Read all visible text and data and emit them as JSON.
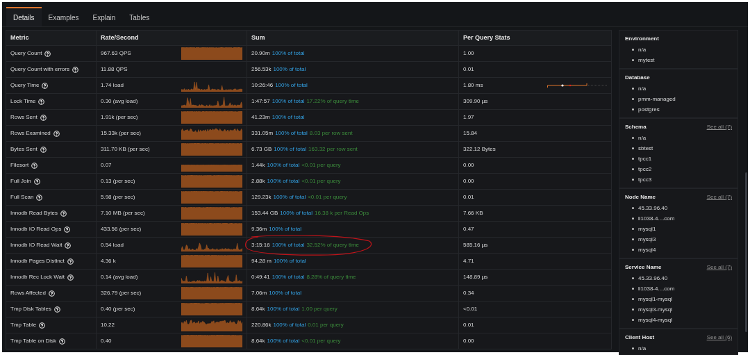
{
  "tabs": [
    {
      "label": "Details",
      "selected": true
    },
    {
      "label": "Examples",
      "selected": false
    },
    {
      "label": "Explain",
      "selected": false
    },
    {
      "label": "Tables",
      "selected": false
    }
  ],
  "table": {
    "columns": [
      "Metric",
      "Rate/Second",
      "Sum",
      "Per Query Stats"
    ],
    "rows": [
      {
        "metric": "Query Count",
        "rate": "967.63 QPS",
        "kind": "flat",
        "sum": "20.90m",
        "pct": "100% of total",
        "per_query": "1.00"
      },
      {
        "metric": "Query Count with errors",
        "rate": "11.88 QPS",
        "kind": "none",
        "sum": "256.53k",
        "pct": "100% of total",
        "per_query": "0.01"
      },
      {
        "metric": "Query Time",
        "rate": "1.74 load",
        "kind": "spiky",
        "sum": "10:26:46",
        "pct": "100% of total",
        "per_query": "1.80 ms",
        "range": true
      },
      {
        "metric": "Lock Time",
        "rate": "0.30 (avg load)",
        "kind": "spiky",
        "sum": "1:47:57",
        "pct": "100% of total",
        "note": "17.22% of query time",
        "per_query": "309.90 µs"
      },
      {
        "metric": "Rows Sent",
        "rate": "1.91k (per sec)",
        "kind": "flat",
        "sum": "41.23m",
        "pct": "100% of total",
        "per_query": "1.97"
      },
      {
        "metric": "Rows Examined",
        "rate": "15.33k (per sec)",
        "kind": "wavy",
        "sum": "331.05m",
        "pct": "100% of total",
        "note": "8.03 per row sent",
        "per_query": "15.84"
      },
      {
        "metric": "Bytes Sent",
        "rate": "311.70 KB (per sec)",
        "kind": "flat",
        "sum": "6.73 GB",
        "pct": "100% of total",
        "note": "163.32 per row sent",
        "per_query": "322.12 Bytes"
      },
      {
        "metric": "Filesort",
        "rate": "0.07",
        "kind": "low",
        "sum": "1.44k",
        "pct": "100% of total",
        "note": "<0.01 per query",
        "per_query": "0.00"
      },
      {
        "metric": "Full Join",
        "rate": "0.13 (per sec)",
        "kind": "flat",
        "sum": "2.88k",
        "pct": "100% of total",
        "note": "<0.01 per query",
        "per_query": "0.00"
      },
      {
        "metric": "Full Scan",
        "rate": "5.98 (per sec)",
        "kind": "flat",
        "sum": "129.23k",
        "pct": "100% of total",
        "note": "<0.01 per query",
        "per_query": "0.01"
      },
      {
        "metric": "Innodb Read Bytes",
        "rate": "7.10 MB (per sec)",
        "kind": "flat",
        "sum": "153.44 GB",
        "pct": "100% of total",
        "note": "16.38 k per Read Ops",
        "per_query": "7.66 KB"
      },
      {
        "metric": "Innodb IO Read Ops",
        "rate": "433.56 (per sec)",
        "kind": "flat",
        "sum": "9.36m",
        "pct": "100% of total",
        "per_query": "0.47"
      },
      {
        "metric": "Innodb IO Read Wait",
        "rate": "0.54 load",
        "kind": "spiky",
        "sum": "3:15:16",
        "pct": "100% of total",
        "note": "32.52% of query time",
        "per_query": "585.16 µs",
        "circled": true
      },
      {
        "metric": "Innodb Pages Distinct",
        "rate": "4.36 k",
        "kind": "flat",
        "sum": "94.28 m",
        "pct": "100% of total",
        "per_query": "4.71"
      },
      {
        "metric": "Innodb Rec Lock Wait",
        "rate": "0.14 (avg load)",
        "kind": "spiky",
        "sum": "0:49:41",
        "pct": "100% of total",
        "note": "8.28% of query time",
        "per_query": "148.89 µs"
      },
      {
        "metric": "Rows Affected",
        "rate": "326.79 (per sec)",
        "kind": "flat",
        "sum": "7.06m",
        "pct": "100% of total",
        "per_query": "0.34"
      },
      {
        "metric": "Tmp Disk Tables",
        "rate": "0.40 (per sec)",
        "kind": "flat",
        "sum": "8.64k",
        "pct": "100% of total",
        "note": "1.00 per query",
        "per_query": "<0.01"
      },
      {
        "metric": "Tmp Table",
        "rate": "10.22",
        "kind": "wavy",
        "sum": "220.86k",
        "pct": "100% of total",
        "note": "0.01 per query",
        "per_query": "0.01"
      },
      {
        "metric": "Tmp Table on Disk",
        "rate": "0.40",
        "kind": "flat",
        "sum": "8.64k",
        "pct": "100% of total",
        "note": "<0.01 per query",
        "per_query": "0.00"
      }
    ]
  },
  "sidebar": [
    {
      "title": "Environment",
      "items": [
        "n/a",
        "mytest"
      ]
    },
    {
      "title": "Database",
      "items": [
        "n/a",
        "pmm-managed",
        "postgres"
      ]
    },
    {
      "title": "Schema",
      "see_all": "See all (7)",
      "items": [
        "n/a",
        "sbtest",
        "tpcc1",
        "tpcc2",
        "tpcc3"
      ]
    },
    {
      "title": "Node Name",
      "see_all": "See all (7)",
      "items": [
        "45.33.96.40",
        "li1038-4....com",
        "mysql1",
        "mysql3",
        "mysql4"
      ]
    },
    {
      "title": "Service Name",
      "see_all": "See all (7)",
      "items": [
        "45.33.96.40",
        "li1038-4....com",
        "mysql1-mysql",
        "mysql3-mysql",
        "mysql4-mysql"
      ]
    },
    {
      "title": "Client Host",
      "see_all": "See all (6)",
      "items": [
        "n/a"
      ]
    }
  ]
}
